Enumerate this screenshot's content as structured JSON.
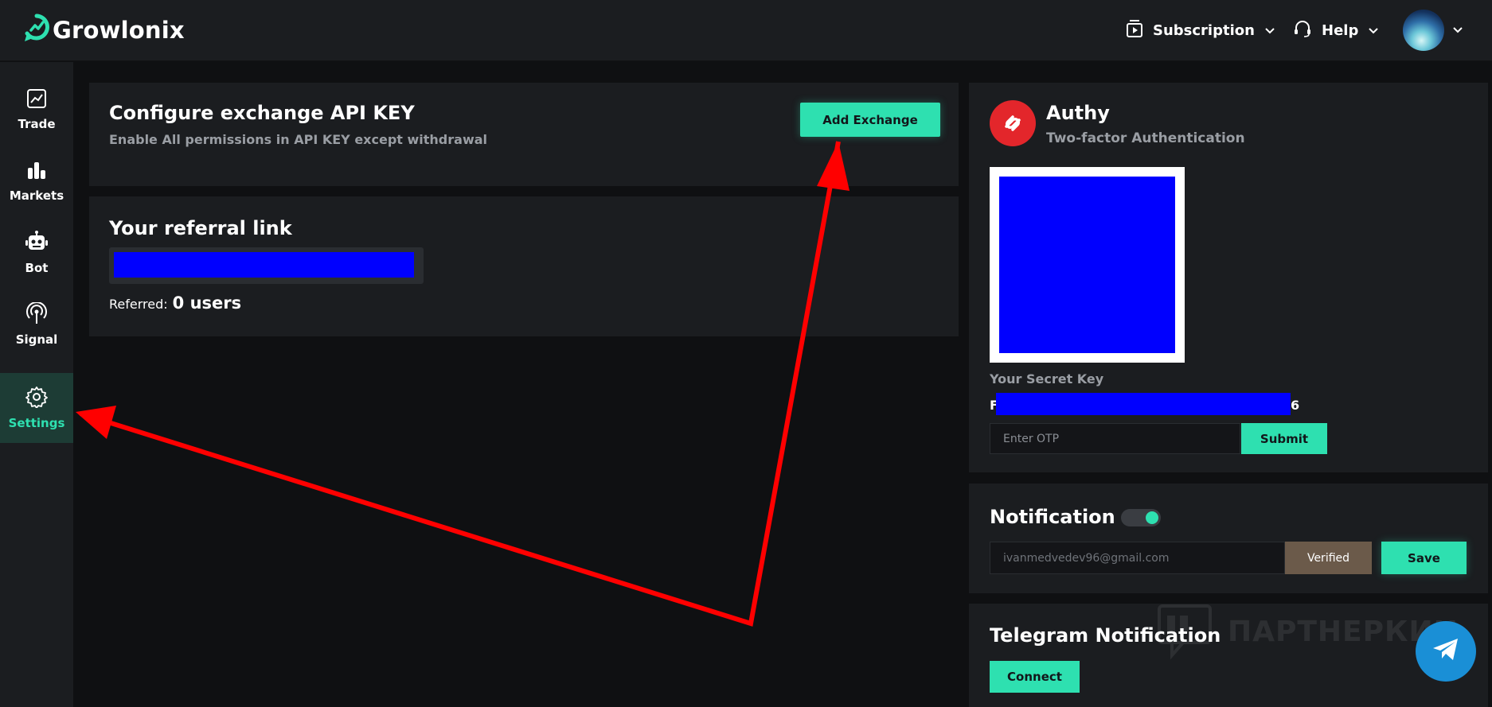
{
  "app": {
    "name": "Growlonix"
  },
  "header": {
    "subscription_label": "Subscription",
    "help_label": "Help"
  },
  "sidebar": {
    "items": [
      {
        "label": "Trade",
        "icon": "chart-line-icon"
      },
      {
        "label": "Markets",
        "icon": "bar-chart-icon"
      },
      {
        "label": "Bot",
        "icon": "robot-icon"
      },
      {
        "label": "Signal",
        "icon": "signal-icon"
      },
      {
        "label": "Settings",
        "icon": "gear-icon",
        "active": true
      }
    ]
  },
  "exchange": {
    "title": "Configure exchange API KEY",
    "subtitle": "Enable All permissions in API KEY except withdrawal",
    "button_label": "Add Exchange"
  },
  "referral": {
    "title": "Your referral link",
    "referred_label": "Referred:",
    "referred_count": "0 users"
  },
  "authy": {
    "title": "Authy",
    "subtitle": "Two-factor Authentication",
    "secret_label": "Your Secret Key",
    "secret_prefix": "F",
    "secret_suffix": "6",
    "otp_placeholder": "Enter OTP",
    "submit_label": "Submit"
  },
  "notification": {
    "title": "Notification",
    "enabled": true,
    "email_value": "ivanmedvedev96@gmail.com",
    "verified_label": "Verified",
    "save_label": "Save"
  },
  "telegram": {
    "title": "Telegram Notification",
    "connect_label": "Connect"
  },
  "watermark": {
    "text": "ПАРТНЕРКИН"
  },
  "colors": {
    "accent": "#2ee0b0",
    "panel": "#1b1d20",
    "background": "#0f1012",
    "verified": "#6b5a4a",
    "fab": "#1a8fd6",
    "annotation_arrow": "#ff0000",
    "redaction": "#0000ff"
  }
}
